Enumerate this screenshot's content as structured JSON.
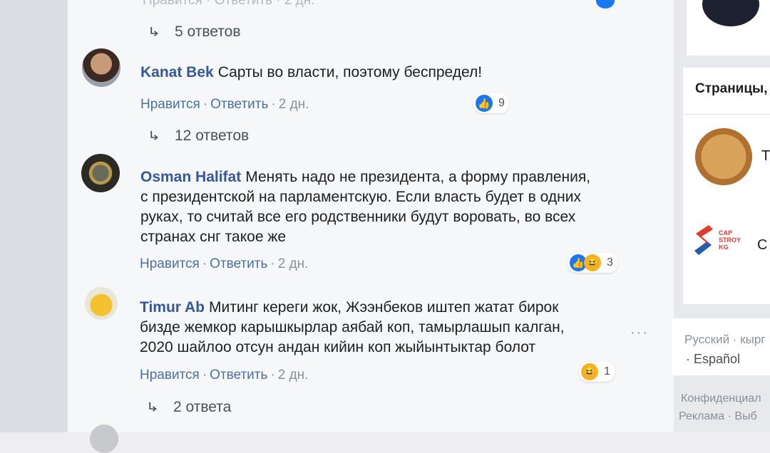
{
  "top_partial": {
    "meta": "Нравится · Ответить · 2 дн."
  },
  "threads": [
    {
      "replies_label": "5 ответов"
    },
    {
      "replies_label": "12 ответов"
    },
    {
      "replies_label": "2 ответа"
    }
  ],
  "comments": [
    {
      "author": "Kanat Bek",
      "text": "Сарты во власти, поэтому беспредел!",
      "like_label": "Нравится",
      "reply_label": "Ответить",
      "time": "2 дн.",
      "reaction_count": "9",
      "reactions": [
        "like-icon"
      ]
    },
    {
      "author": "Osman Halifat",
      "text_lines": [
        "Менять надо не президента, а форму правления,",
        "с президентской на парламентскую. Если власть будет в одних",
        "руках, то считай все его родственники будут воровать, во всех",
        "странах снг такое же"
      ],
      "like_label": "Нравится",
      "reply_label": "Ответить",
      "time": "2 дн.",
      "reaction_count": "3",
      "reactions": [
        "like-icon",
        "haha-icon"
      ]
    },
    {
      "author": "Timur Ab",
      "text_lines": [
        "Митинг кереги жок, Жээнбеков иштеп жатат бирок",
        "бизде жемкор карышкырлар аябай коп, тамырлашып калган,",
        "2020 шайлоо отсун андан кийин коп жыйынтыктар болот"
      ],
      "like_label": "Нравится",
      "reply_label": "Ответить",
      "time": "2 дн.",
      "reaction_count": "1",
      "reactions": [
        "haha-icon"
      ]
    }
  ],
  "sidebar": {
    "pages_header": "Страницы,",
    "page1_initial": "T",
    "page2_logo_text": "CAP STROY KG",
    "page2_initial": "C",
    "lang_current": "Русский · кырг",
    "lang_other": "· Español",
    "footer_line1": "Конфиденциал",
    "footer_line2": "Реклама · Выб"
  },
  "colors": {
    "link": "#4b6fa6",
    "author": "#365899",
    "like_blue": "#1877f2",
    "haha_yellow": "#f7b125"
  }
}
